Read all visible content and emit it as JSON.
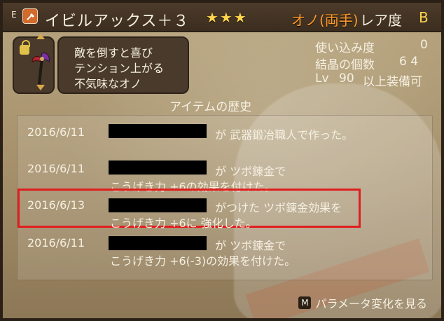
{
  "header": {
    "prefix": "E",
    "item_name": "イビルアックス＋３",
    "stars": "★★★",
    "weapon_type": "オノ(両手)",
    "rarity_label": "レア度",
    "rarity_value": "B",
    "badge_icon": "swordsmith-badge-icon"
  },
  "item": {
    "lock_icon": "lock-icon",
    "weapon_icon": "evil-axe-icon",
    "description_lines": [
      "敵を倒すと喜び",
      "テンション上がる",
      "不気味なオノ"
    ]
  },
  "stats": {
    "usage_label": "使い込み度",
    "usage_value": "0",
    "crystals_label": "結晶の個数",
    "crystals_value": "6 4",
    "lv_label": "Lv",
    "lv_value": "90",
    "lv_suffix": "以上装備可"
  },
  "history": {
    "title": "アイテムの歴史",
    "entries": [
      {
        "date": "2016/6/11",
        "lines": [
          "が 武器鍛冶職人で作った。"
        ]
      },
      {
        "date": "2016/6/11",
        "lines": [
          "が ツボ錬金で",
          "こうげき力 +6の効果を付けた。"
        ]
      },
      {
        "date": "2016/6/13",
        "lines": [
          "がつけた ツボ錬金効果を",
          "こうげき力 +6に 強化した。"
        ]
      },
      {
        "date": "2016/6/11",
        "lines": [
          "が ツボ錬金で",
          "こうげき力 +6(-3)の効果を付けた。"
        ]
      }
    ]
  },
  "footer": {
    "key": "M",
    "label": "パラメータ変化を見る"
  },
  "colors": {
    "highlight": "#e01e1e",
    "star": "#ffd54d",
    "type": "#ff9a2a"
  }
}
